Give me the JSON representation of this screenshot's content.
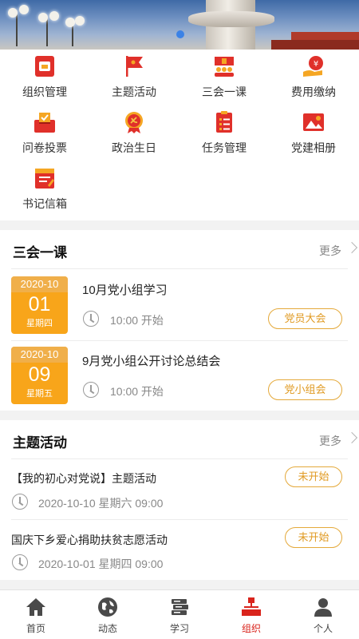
{
  "banner": {
    "active_dot": 1
  },
  "grid": [
    {
      "label": "组织管理",
      "icon": "org-management-icon"
    },
    {
      "label": "主题活动",
      "icon": "flag-icon"
    },
    {
      "label": "三会一课",
      "icon": "meeting-icon"
    },
    {
      "label": "费用缴纳",
      "icon": "fee-payment-icon"
    },
    {
      "label": "问卷投票",
      "icon": "vote-icon"
    },
    {
      "label": "政治生日",
      "icon": "party-badge-icon"
    },
    {
      "label": "任务管理",
      "icon": "task-list-icon"
    },
    {
      "label": "党建相册",
      "icon": "photo-album-icon"
    },
    {
      "label": "书记信箱",
      "icon": "mailbox-icon"
    }
  ],
  "lessons": {
    "title": "三会一课",
    "more": "更多",
    "items": [
      {
        "ym": "2020-10",
        "day": "01",
        "weekday": "星期四",
        "title": "10月党小组学习",
        "time": "10:00 开始",
        "tag": "党员大会"
      },
      {
        "ym": "2020-10",
        "day": "09",
        "weekday": "星期五",
        "title": "9月党小组公开讨论总结会",
        "time": "10:00 开始",
        "tag": "党小组会"
      }
    ]
  },
  "activities": {
    "title": "主题活动",
    "more": "更多",
    "items": [
      {
        "title": "【我的初心对党说】主题活动",
        "datetime": "2020-10-10 星期六 09:00",
        "status": "未开始"
      },
      {
        "title": "国庆下乡爱心捐助扶贫志愿活动",
        "datetime": "2020-10-01 星期四 09:00",
        "status": "未开始"
      }
    ]
  },
  "tabbar": {
    "active": 3,
    "items": [
      {
        "label": "首页",
        "icon": "home-icon"
      },
      {
        "label": "动态",
        "icon": "globe-icon"
      },
      {
        "label": "学习",
        "icon": "book-icon"
      },
      {
        "label": "组织",
        "icon": "organization-icon"
      },
      {
        "label": "个人",
        "icon": "person-icon"
      }
    ]
  },
  "colors": {
    "accent_red": "#d9241c",
    "accent_orange": "#f8a51a",
    "tag_border": "#e4a93a"
  }
}
